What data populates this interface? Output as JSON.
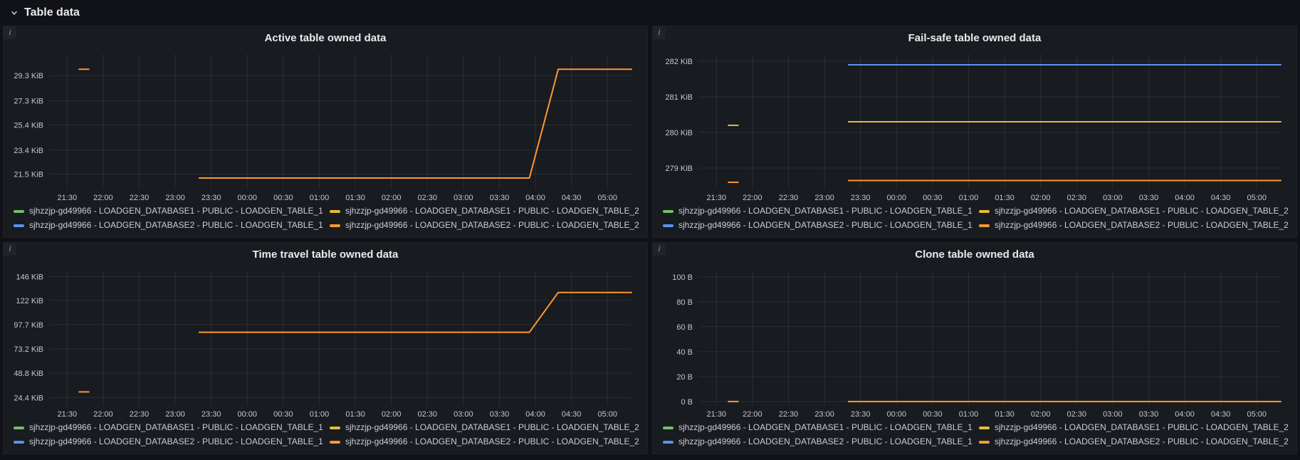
{
  "header": {
    "row_title": "Table data"
  },
  "panel_ui": {
    "info_icon_glyph": "i"
  },
  "chart_data": {
    "type": "line",
    "x_axis": {
      "domain_min": 0,
      "domain_max": 485,
      "unit": "minutes from 21:15",
      "ticks": [
        {
          "t": 15,
          "label": "21:30"
        },
        {
          "t": 45,
          "label": "22:00"
        },
        {
          "t": 75,
          "label": "22:30"
        },
        {
          "t": 105,
          "label": "23:00"
        },
        {
          "t": 135,
          "label": "23:30"
        },
        {
          "t": 165,
          "label": "00:00"
        },
        {
          "t": 195,
          "label": "00:30"
        },
        {
          "t": 225,
          "label": "01:00"
        },
        {
          "t": 255,
          "label": "01:30"
        },
        {
          "t": 285,
          "label": "02:00"
        },
        {
          "t": 315,
          "label": "02:30"
        },
        {
          "t": 345,
          "label": "03:00"
        },
        {
          "t": 375,
          "label": "03:30"
        },
        {
          "t": 405,
          "label": "04:00"
        },
        {
          "t": 435,
          "label": "04:30"
        },
        {
          "t": 465,
          "label": "05:00"
        }
      ]
    },
    "legend": [
      {
        "color": "#73BF69",
        "label": "sjhzzjp-gd49966 - LOADGEN_DATABASE1 - PUBLIC - LOADGEN_TABLE_1"
      },
      {
        "color": "#EAB839",
        "label": "sjhzzjp-gd49966 - LOADGEN_DATABASE1 - PUBLIC - LOADGEN_TABLE_2"
      },
      {
        "color": "#5794F2",
        "label": "sjhzzjp-gd49966 - LOADGEN_DATABASE2 - PUBLIC - LOADGEN_TABLE_1"
      },
      {
        "color": "#FF9830",
        "label": "sjhzzjp-gd49966 - LOADGEN_DATABASE2 - PUBLIC - LOADGEN_TABLE_2"
      }
    ],
    "charts": [
      {
        "title": "Active table owned data",
        "y_axis": {
          "min": 20.3,
          "max": 31.0,
          "unit": "KiB",
          "ticks": [
            {
              "v": 21.5,
              "label": "21.5 KiB"
            },
            {
              "v": 23.4,
              "label": "23.4 KiB"
            },
            {
              "v": 25.4,
              "label": "25.4 KiB"
            },
            {
              "v": 27.3,
              "label": "27.3 KiB"
            },
            {
              "v": 29.3,
              "label": "29.3 KiB"
            }
          ]
        },
        "series": [
          {
            "name": "sjhzzjp-gd49966 - LOADGEN_DATABASE2 - PUBLIC - LOADGEN_TABLE_2",
            "color": "#FF9830",
            "segments": [
              [
                [
                  25,
                  29.8
                ],
                [
                  33,
                  29.8
                ]
              ],
              [
                [
                  125,
                  21.2
                ],
                [
                  400,
                  21.2
                ],
                [
                  424,
                  29.8
                ],
                [
                  485,
                  29.8
                ]
              ]
            ]
          }
        ]
      },
      {
        "title": "Fail-safe table owned data",
        "y_axis": {
          "min": 278.4,
          "max": 282.2,
          "unit": "KiB",
          "ticks": [
            {
              "v": 279,
              "label": "279 KiB"
            },
            {
              "v": 280,
              "label": "280 KiB"
            },
            {
              "v": 281,
              "label": "281 KiB"
            },
            {
              "v": 282,
              "label": "282 KiB"
            }
          ]
        },
        "series": [
          {
            "name": "sjhzzjp-gd49966 - LOADGEN_DATABASE2 - PUBLIC - LOADGEN_TABLE_1",
            "color": "#5794F2",
            "segments": [
              [
                [
                  125,
                  281.9
                ],
                [
                  485,
                  281.9
                ]
              ]
            ]
          },
          {
            "name": "sjhzzjp-gd49966 - LOADGEN_DATABASE1 - PUBLIC - LOADGEN_TABLE_2",
            "color": "#EAB839",
            "segments": [
              [
                [
                  25,
                  280.2
                ],
                [
                  33,
                  280.2
                ]
              ],
              [
                [
                  125,
                  280.3
                ],
                [
                  485,
                  280.3
                ]
              ]
            ]
          },
          {
            "name": "sjhzzjp-gd49966 - LOADGEN_DATABASE2 - PUBLIC - LOADGEN_TABLE_2",
            "color": "#FF9830",
            "segments": [
              [
                [
                  25,
                  278.6
                ],
                [
                  33,
                  278.6
                ]
              ],
              [
                [
                  125,
                  278.65
                ],
                [
                  485,
                  278.65
                ]
              ]
            ]
          }
        ]
      },
      {
        "title": "Time travel table owned data",
        "y_axis": {
          "min": 16,
          "max": 152,
          "unit": "KiB",
          "ticks": [
            {
              "v": 24.4,
              "label": "24.4 KiB"
            },
            {
              "v": 48.8,
              "label": "48.8 KiB"
            },
            {
              "v": 73.2,
              "label": "73.2 KiB"
            },
            {
              "v": 97.7,
              "label": "97.7 KiB"
            },
            {
              "v": 122,
              "label": "122 KiB"
            },
            {
              "v": 146,
              "label": "146 KiB"
            }
          ]
        },
        "series": [
          {
            "name": "sjhzzjp-gd49966 - LOADGEN_DATABASE2 - PUBLIC - LOADGEN_TABLE_2",
            "color": "#FF9830",
            "segments": [
              [
                [
                  25,
                  30
                ],
                [
                  33,
                  30
                ]
              ],
              [
                [
                  125,
                  90
                ],
                [
                  400,
                  90
                ],
                [
                  424,
                  130
                ],
                [
                  485,
                  130
                ]
              ]
            ]
          }
        ]
      },
      {
        "title": "Clone table owned data",
        "y_axis": {
          "min": -3.5,
          "max": 105,
          "unit": "B",
          "ticks": [
            {
              "v": 0,
              "label": "0 B"
            },
            {
              "v": 20,
              "label": "20 B"
            },
            {
              "v": 40,
              "label": "40 B"
            },
            {
              "v": 60,
              "label": "60 B"
            },
            {
              "v": 80,
              "label": "80 B"
            },
            {
              "v": 100,
              "label": "100 B"
            }
          ]
        },
        "series": [
          {
            "name": "sjhzzjp-gd49966 - LOADGEN_DATABASE2 - PUBLIC - LOADGEN_TABLE_2",
            "color": "#FF9830",
            "segments": [
              [
                [
                  25,
                  0
                ],
                [
                  33,
                  0
                ]
              ],
              [
                [
                  125,
                  0
                ],
                [
                  485,
                  0
                ]
              ]
            ]
          }
        ]
      }
    ]
  }
}
